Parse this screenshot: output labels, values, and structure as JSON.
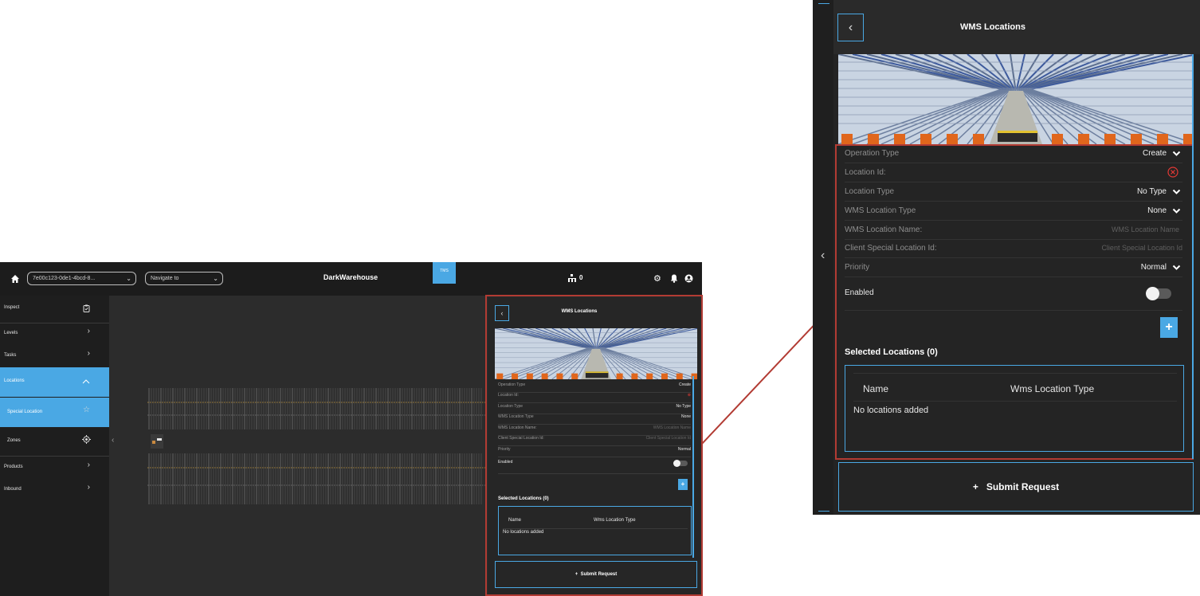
{
  "app": {
    "warehouse_select": "7e00c123-0de1-4bcd-8...",
    "navigate_placeholder": "Navigate to",
    "brand": "DarkWarehouse",
    "tms_tab": "TMS",
    "robot_count": "0"
  },
  "sidebar": {
    "items": [
      {
        "label": "Inspect"
      },
      {
        "label": "Levels"
      },
      {
        "label": "Tasks"
      },
      {
        "label": "Locations"
      },
      {
        "label": "Special Location"
      },
      {
        "label": "Zones"
      },
      {
        "label": "Products"
      },
      {
        "label": "Inbound"
      }
    ]
  },
  "panel": {
    "title": "WMS Locations",
    "fields": {
      "operation_type": {
        "label": "Operation Type",
        "value": "Create"
      },
      "location_id": {
        "label": "Location Id:"
      },
      "location_type": {
        "label": "Location Type",
        "value": "No Type"
      },
      "wms_location_type": {
        "label": "WMS Location Type",
        "value": "None"
      },
      "wms_location_name": {
        "label": "WMS Location Name:",
        "placeholder": "WMS Location Name"
      },
      "client_special_location_id": {
        "label": "Client Special Location Id:",
        "placeholder": "Client Special Location Id"
      },
      "priority": {
        "label": "Priority",
        "value": "Normal"
      },
      "enabled": {
        "label": "Enabled",
        "on": false
      }
    },
    "add_button": "+",
    "selected_heading": "Selected Locations (0)",
    "table": {
      "columns": [
        "Name",
        "Wms Location Type"
      ],
      "empty": "No locations added"
    },
    "submit": "Submit Request"
  },
  "colors": {
    "accent": "#4aa8e4",
    "highlight": "#b23b33",
    "error": "#e53935"
  }
}
